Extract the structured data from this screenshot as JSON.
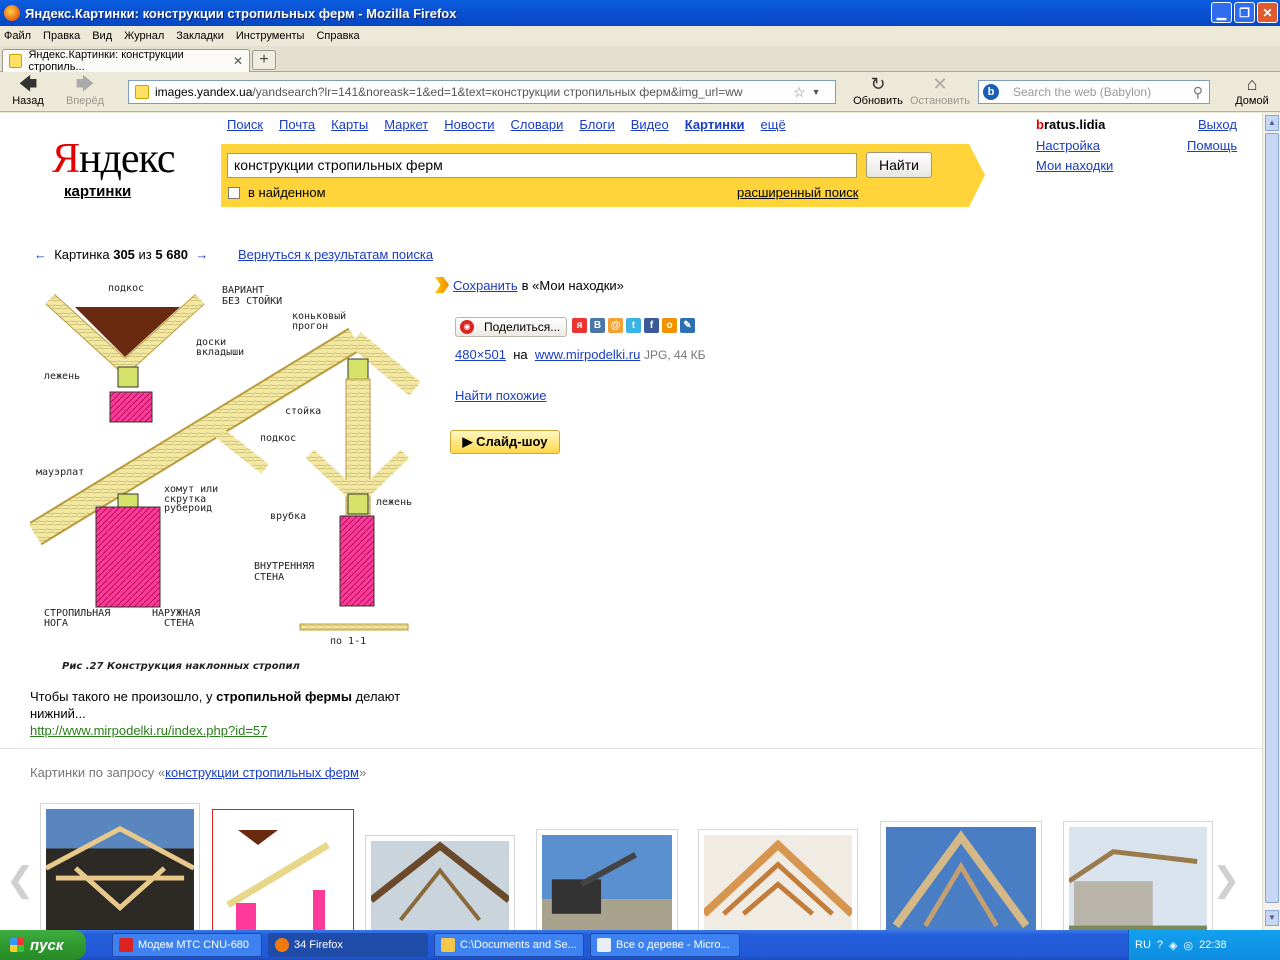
{
  "window": {
    "title": "Яндекс.Картинки: конструкции стропильных ферм - Mozilla Firefox",
    "min_glyph": "▁",
    "max_glyph": "❐",
    "close_glyph": "✕"
  },
  "menu": [
    "Файл",
    "Правка",
    "Вид",
    "Журнал",
    "Закладки",
    "Инструменты",
    "Справка"
  ],
  "tab": {
    "title": "Яндекс.Картинки: конструкции стропиль...",
    "close_glyph": "✕",
    "new_glyph": "+"
  },
  "nav": {
    "back_label": "Назад",
    "forward_label": "Вперёд",
    "reload_label": "Обновить",
    "stop_label": "Остановить",
    "home_label": "Домой",
    "url_host": "images.yandex.ua",
    "url_rest": "/yandsearch?lr=141&noreask=1&ed=1&text=конструкции стропильных ферм&img_url=ww",
    "search_placeholder": "Search the web (Babylon)"
  },
  "yandex": {
    "logo_first": "Я",
    "logo_rest": "ндекс",
    "logo_sub": "картинки",
    "services": [
      "Поиск",
      "Почта",
      "Карты",
      "Маркет",
      "Новости",
      "Словари",
      "Блоги",
      "Видео",
      "Картинки",
      "ещё"
    ],
    "active_service_index": 8,
    "query": "конструкции стропильных ферм",
    "find_button": "Найти",
    "in_found_label": "в найденном",
    "advanced_search": "расширенный поиск",
    "user_first": "b",
    "user_rest": "ratus.lidia",
    "logout": "Выход",
    "settings": "Настройка",
    "help": "Помощь",
    "my_finds": "Мои находки"
  },
  "pager": {
    "prev_arrow": "←",
    "next_arrow": "→",
    "label": "Картинка",
    "current": "305",
    "of": "из",
    "total": "5 680",
    "back_to_results": "Вернуться к результатам поиска"
  },
  "image": {
    "caption_before": "Чтобы такого не произошло, у ",
    "caption_bold": "стропильной фермы",
    "caption_after": " делают нижний...",
    "source_url": "http://www.mirpodelki.ru/index.php?id=57",
    "labels": {
      "podkos_top": "подкос",
      "variant1": "ВАРИАНТ",
      "variant2": "БЕЗ СТОЙКИ",
      "konk1": "коньковый",
      "konk2": "прогон",
      "doski1": "доски",
      "doski2": "вкладыши",
      "lezhen_left": "лежень",
      "stoyka": "стойка",
      "podkos_mid": "подкос",
      "mauerlat": "мауэрлат",
      "homut1": "хомут или",
      "homut2": "скрутка",
      "homut3": "рубероид",
      "vrubka": "врубка",
      "lezhen_right": "лежень",
      "vnutr1": "ВНУТРЕННЯЯ",
      "vnutr2": "СТЕНА",
      "strop1": "СТРОПИЛЬНАЯ",
      "strop2": "НОГА",
      "narug1": "НАРУЖНАЯ",
      "narug2": "СТЕНА",
      "section": "по 1-1",
      "figure_caption": "Рис .27 Конструкция наклонных стропил"
    }
  },
  "side": {
    "save_link": "Сохранить",
    "save_suffix": " в «Мои находки»",
    "share_button": "Поделиться...",
    "dimensions": "480×501",
    "on": "на",
    "site": "www.mirpodelki.ru",
    "file_info": "JPG, 44 КБ",
    "find_similar": "Найти похожие",
    "slideshow": "▶ Слайд-шоу",
    "social_icons": [
      "ya-icon",
      "vkontakte-icon",
      "moimir-icon",
      "twitter-icon",
      "facebook-icon",
      "odnoklassniki-icon",
      "livejournal-icon"
    ]
  },
  "related": {
    "prefix": "Картинки по запросу «",
    "query": "конструкции стропильных ферм",
    "suffix": "»"
  },
  "taskbar": {
    "start": "пуск",
    "tasks": [
      "Модем МТС CNU-680",
      "34 Firefox",
      "C:\\Documents and Se...",
      "Все о дереве - Micro..."
    ],
    "lang": "RU",
    "time": "22:38"
  }
}
